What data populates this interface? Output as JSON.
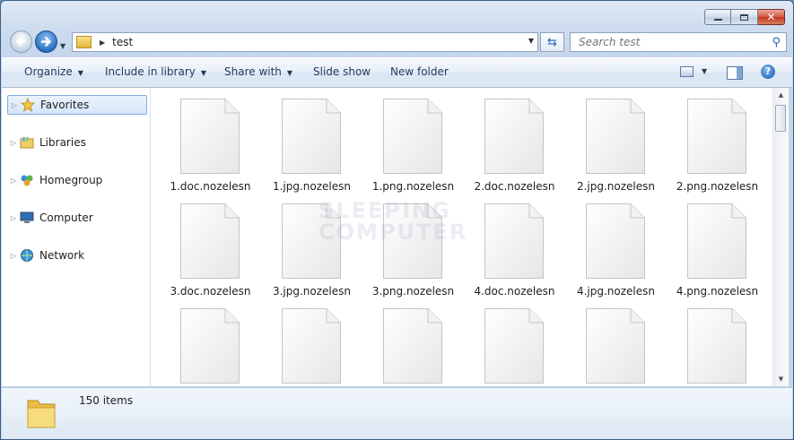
{
  "window": {
    "caption": {
      "minimize": "minimize-icon",
      "maximize": "maximize-icon",
      "close": "close-icon"
    }
  },
  "nav": {
    "back": "back-arrow-icon",
    "forward": "forward-arrow-icon",
    "address_path": "test",
    "search_placeholder": "Search test"
  },
  "toolbar": {
    "organize": "Organize",
    "include_in_library": "Include in library",
    "share_with": "Share with",
    "slide_show": "Slide show",
    "new_folder": "New folder"
  },
  "navpane": {
    "items": [
      {
        "label": "Favorites",
        "icon": "star-icon"
      },
      {
        "label": "Libraries",
        "icon": "libraries-icon"
      },
      {
        "label": "Homegroup",
        "icon": "homegroup-icon"
      },
      {
        "label": "Computer",
        "icon": "computer-icon"
      },
      {
        "label": "Network",
        "icon": "network-icon"
      }
    ]
  },
  "files": [
    {
      "name": "1.doc.nozelesn"
    },
    {
      "name": "1.jpg.nozelesn"
    },
    {
      "name": "1.png.nozelesn"
    },
    {
      "name": "2.doc.nozelesn"
    },
    {
      "name": "2.jpg.nozelesn"
    },
    {
      "name": "2.png.nozelesn"
    },
    {
      "name": "3.doc.nozelesn"
    },
    {
      "name": "3.jpg.nozelesn"
    },
    {
      "name": "3.png.nozelesn"
    },
    {
      "name": "4.doc.nozelesn"
    },
    {
      "name": "4.jpg.nozelesn"
    },
    {
      "name": "4.png.nozelesn"
    },
    {
      "name": ""
    },
    {
      "name": ""
    },
    {
      "name": ""
    },
    {
      "name": ""
    },
    {
      "name": ""
    },
    {
      "name": ""
    }
  ],
  "watermark": [
    "SLEEPING",
    "COMPUTER"
  ],
  "details": {
    "item_count": "150 items"
  },
  "colors": {
    "selection": "#d5e6fb",
    "toolbar_text": "#1e395b",
    "close_button": "#c2361f"
  }
}
